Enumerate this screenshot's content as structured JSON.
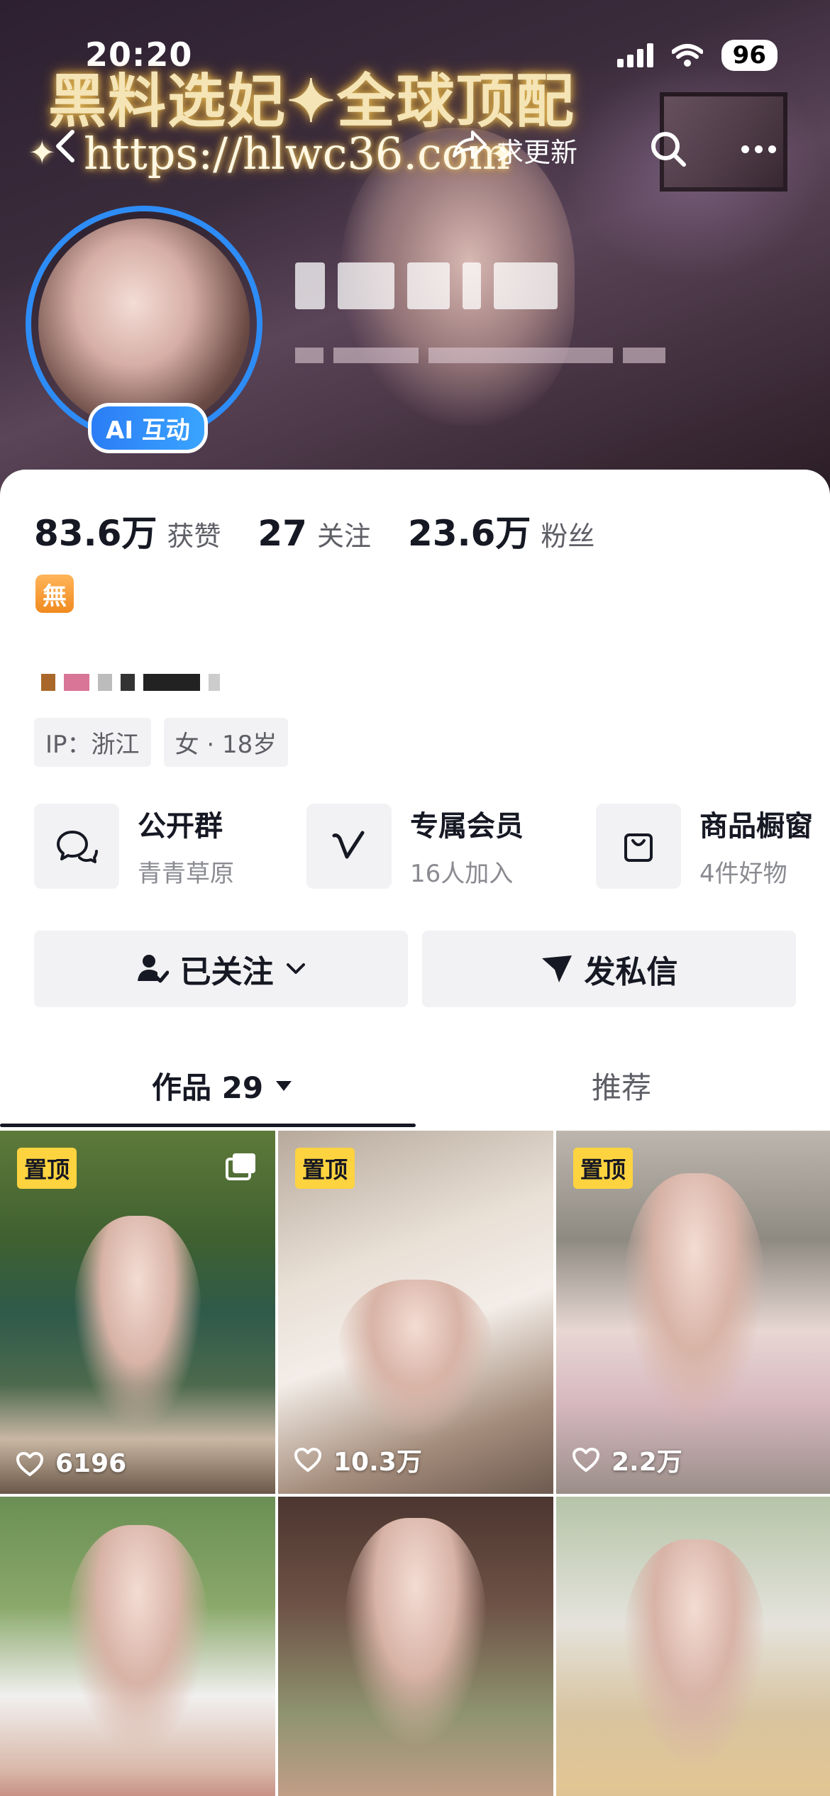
{
  "status_bar": {
    "time": "20:20",
    "battery": "96"
  },
  "banner": {
    "promo_title": "黑料选妃✦全球顶配",
    "promo_url": "https://hlwc36.com",
    "update_text": "求更新"
  },
  "profile": {
    "ai_badge": "AI 互动",
    "stats": [
      {
        "value": "83.6万",
        "label": "获赞"
      },
      {
        "value": "27",
        "label": "关注"
      },
      {
        "value": "23.6万",
        "label": "粉丝"
      }
    ],
    "emoji_badge": "無",
    "tags": [
      "IP：浙江",
      "女 · 18岁"
    ]
  },
  "features": [
    {
      "title": "公开群",
      "sub": "青青草原",
      "icon": "group-chat-icon"
    },
    {
      "title": "专属会员",
      "sub": "16人加入",
      "icon": "membership-v-icon"
    },
    {
      "title": "商品橱窗",
      "sub": "4件好物",
      "icon": "shopping-bag-icon"
    }
  ],
  "actions": {
    "follow": "已关注",
    "message": "发私信"
  },
  "tabs": {
    "works": "作品 29",
    "recommend": "推荐"
  },
  "grid": [
    {
      "pinned": "置顶",
      "likes": "6196",
      "multi": true
    },
    {
      "pinned": "置顶",
      "likes": "10.3万"
    },
    {
      "pinned": "置顶",
      "likes": "2.2万"
    },
    {
      "pinned": "",
      "likes": ""
    },
    {
      "pinned": "",
      "likes": ""
    },
    {
      "pinned": "",
      "likes": ""
    }
  ],
  "colors": {
    "accent_blue": "#2e8cf7",
    "pin_yellow": "#fdd33f",
    "text": "#161823",
    "muted": "#5e5f66"
  }
}
